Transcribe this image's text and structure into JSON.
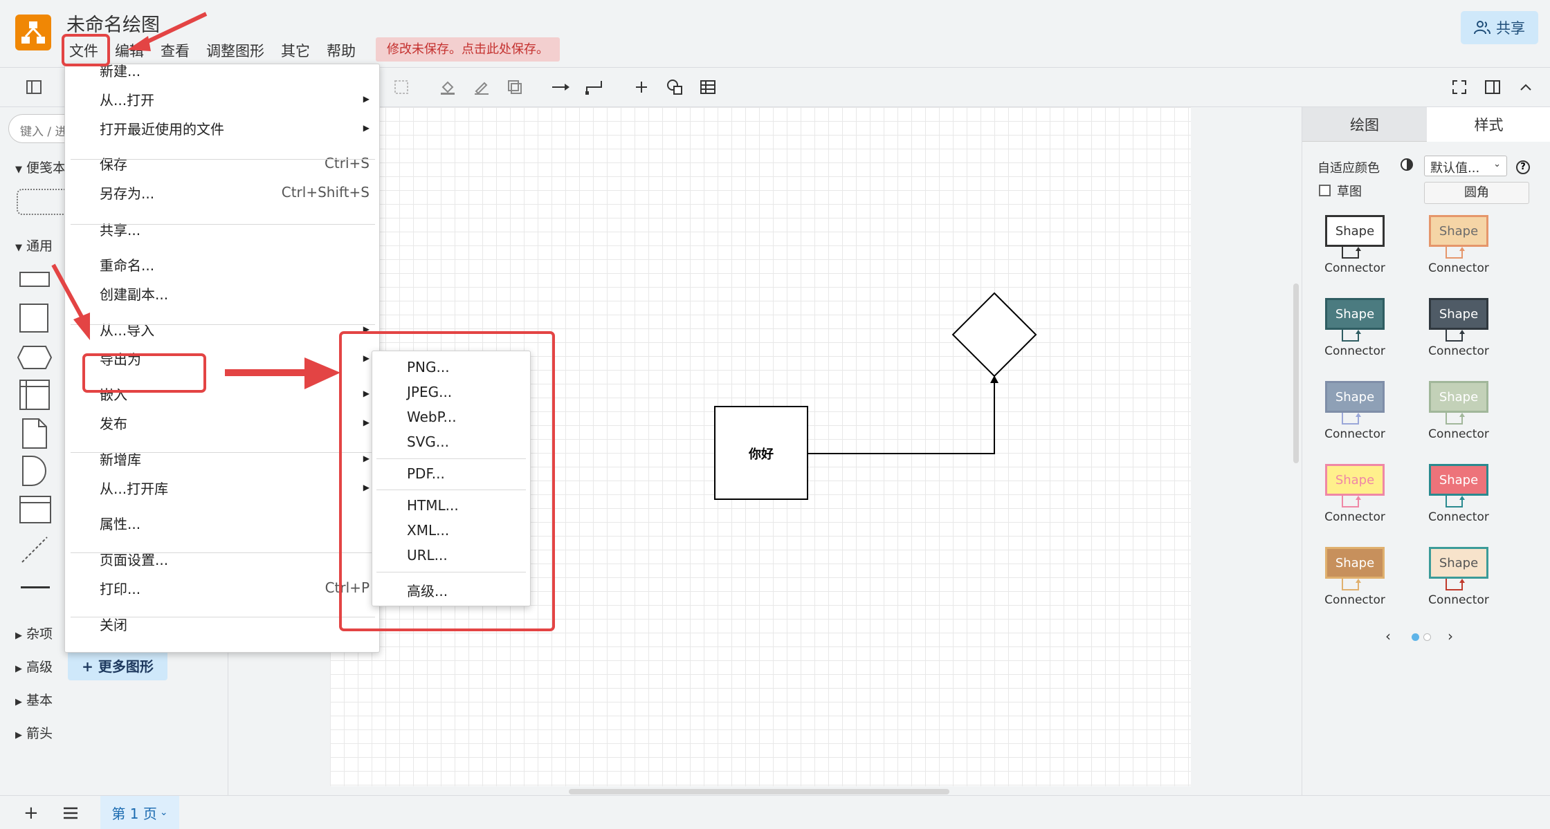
{
  "header": {
    "title": "未命名绘图",
    "menu": [
      "文件",
      "编辑",
      "查看",
      "调整图形",
      "其它",
      "帮助"
    ],
    "unsaved_notice": "修改未保存。点击此处保存。",
    "share_label": "共享"
  },
  "left_panel": {
    "search_placeholder": "键入 / 进行搜索",
    "sections": {
      "notes": "便笺本",
      "general": "通用",
      "misc": "杂项",
      "advanced": "高级",
      "basic": "基本",
      "arrows": "箭头"
    },
    "more_shapes": "+ 更多图形"
  },
  "canvas": {
    "box_text": "你好"
  },
  "right_panel": {
    "tabs": [
      "绘图",
      "样式"
    ],
    "adaptive_color_label": "自适应颜色",
    "default_value": "默认值...",
    "sketch_label": "草图",
    "rounded_label": "圆角",
    "style_shape_label": "Shape",
    "style_connector_label": "Connector",
    "colors": {
      "styles": [
        {
          "fill": "#ffffff",
          "stroke": "#333333",
          "font": "#333333",
          "line": "#333333"
        },
        {
          "fill": "#f5d5a6",
          "stroke": "#e5966b",
          "font": "#6b6b6b",
          "line": "#e5966b"
        },
        {
          "fill": "#4b7b80",
          "stroke": "#2f5d62",
          "font": "#ffffff",
          "line": "#2f5d62"
        },
        {
          "fill": "#4f5b66",
          "stroke": "#30383f",
          "font": "#ffffff",
          "line": "#30383f"
        },
        {
          "fill": "#8ea0b6",
          "stroke": "#7f8ea8",
          "font": "#ffffff",
          "line": "#9aa7d8"
        },
        {
          "fill": "#c3d1b8",
          "stroke": "#a1b79a",
          "font": "#ffffff",
          "line": "#a1b79a"
        },
        {
          "fill": "#fff08c",
          "stroke": "#ef87a6",
          "font": "#ef87a6",
          "line": "#ef87a6"
        },
        {
          "fill": "#ed737a",
          "stroke": "#2a8a8f",
          "font": "#ffffff",
          "line": "#2a8a8f"
        },
        {
          "fill": "#c7905c",
          "stroke": "#e0b06e",
          "font": "#ffffff",
          "line": "#e0b06e"
        },
        {
          "fill": "#f7e3cb",
          "stroke": "#3b9b99",
          "font": "#555555",
          "line": "#c0392b"
        }
      ]
    }
  },
  "file_menu": {
    "items": [
      {
        "label": "新建...",
        "shortcut": ""
      },
      {
        "label": "从...打开",
        "shortcut": ""
      },
      {
        "label": "打开最近使用的文件",
        "shortcut": ""
      },
      {
        "label": "保存",
        "shortcut": "Ctrl+S"
      },
      {
        "label": "另存为...",
        "shortcut": "Ctrl+Shift+S"
      },
      {
        "label": "共享...",
        "shortcut": ""
      },
      {
        "label": "重命名...",
        "shortcut": ""
      },
      {
        "label": "创建副本...",
        "shortcut": ""
      },
      {
        "label": "从...导入",
        "shortcut": ""
      },
      {
        "label": "导出为",
        "shortcut": ""
      },
      {
        "label": "嵌入",
        "shortcut": ""
      },
      {
        "label": "发布",
        "shortcut": ""
      },
      {
        "label": "新增库",
        "shortcut": ""
      },
      {
        "label": "从...打开库",
        "shortcut": ""
      },
      {
        "label": "属性...",
        "shortcut": ""
      },
      {
        "label": "页面设置...",
        "shortcut": ""
      },
      {
        "label": "打印...",
        "shortcut": "Ctrl+P"
      },
      {
        "label": "关闭",
        "shortcut": ""
      }
    ]
  },
  "export_menu": {
    "items": [
      "PNG...",
      "JPEG...",
      "WebP...",
      "SVG...",
      "PDF...",
      "HTML...",
      "XML...",
      "URL...",
      "高级..."
    ]
  },
  "bottom_bar": {
    "page_label": "第 1 页"
  },
  "annotation_color": "#e34444",
  "accent_color": "#f08705"
}
